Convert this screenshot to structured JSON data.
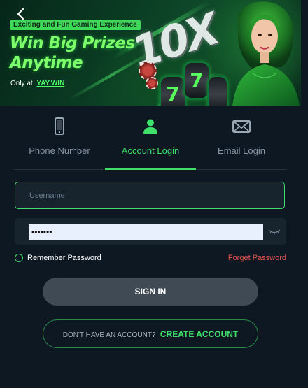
{
  "banner": {
    "tagline": "Exciting and Fun Gaming Experience",
    "title_line1": "Win Big Prizes",
    "title_line2": "Anytime",
    "only_at": "Only at",
    "site": "YAY.WIN",
    "promo_text": "10X",
    "reel_symbol": "7"
  },
  "tabs": [
    {
      "label": "Phone Number",
      "icon": "phone-icon",
      "active": false
    },
    {
      "label": "Account Login",
      "icon": "user-icon",
      "active": true
    },
    {
      "label": "Email Login",
      "icon": "envelope-icon",
      "active": false
    }
  ],
  "form": {
    "username_placeholder": "Username",
    "username_value": "",
    "password_value": "•••••••",
    "remember_label": "Remember Password",
    "forgot_label": "Forget Password",
    "signin_label": "SIGN IN",
    "no_account_text": "DON'T HAVE AN ACCOUNT?",
    "create_account_label": "CREATE ACCOUNT"
  },
  "colors": {
    "accent": "#3fe06a",
    "background": "#0d1822",
    "field": "#17232d",
    "signin_button": "#3f4a54",
    "forgot": "#e1554d"
  }
}
